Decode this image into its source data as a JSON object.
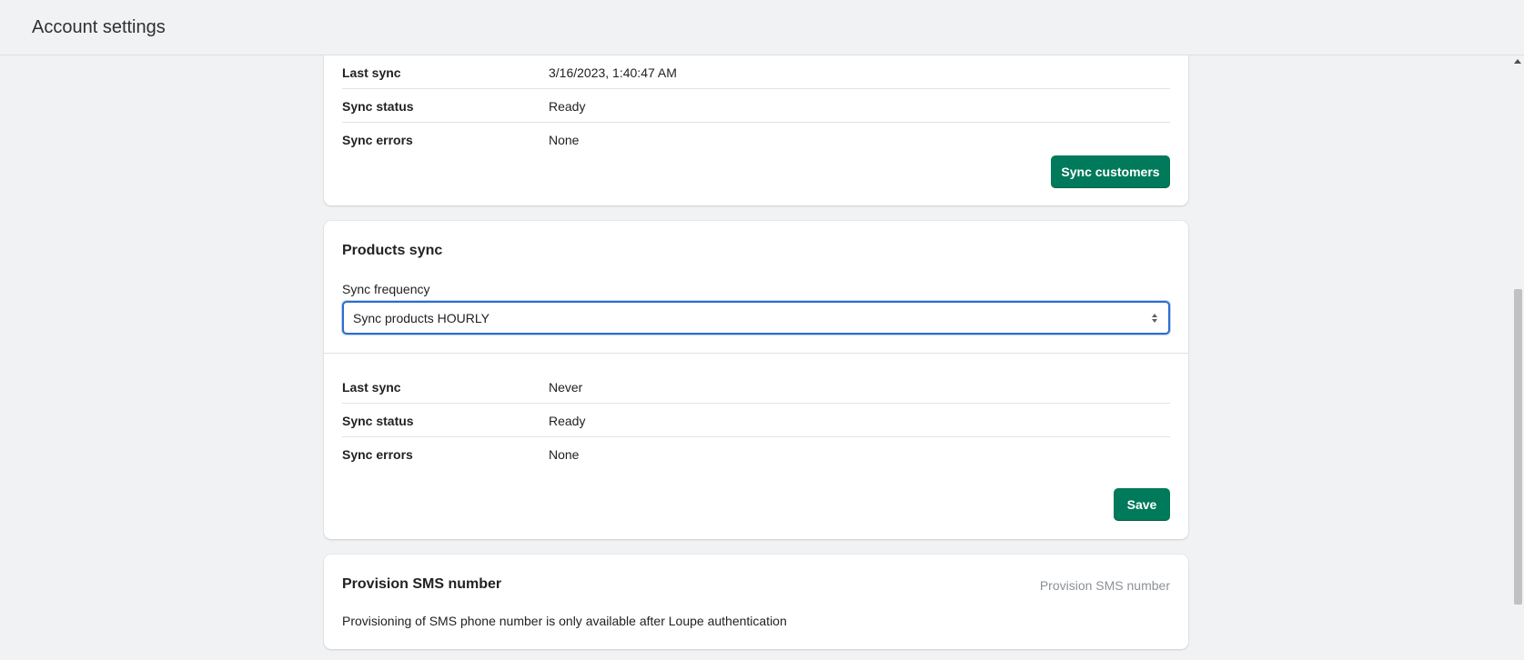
{
  "header": {
    "title": "Account settings"
  },
  "customers_sync": {
    "rows": [
      {
        "key": "Last sync",
        "value": "3/16/2023, 1:40:47 AM"
      },
      {
        "key": "Sync status",
        "value": "Ready"
      },
      {
        "key": "Sync errors",
        "value": "None"
      }
    ],
    "button_label": "Sync customers"
  },
  "products_sync": {
    "title": "Products sync",
    "frequency_label": "Sync frequency",
    "frequency_value": "Sync products HOURLY",
    "rows": [
      {
        "key": "Last sync",
        "value": "Never"
      },
      {
        "key": "Sync status",
        "value": "Ready"
      },
      {
        "key": "Sync errors",
        "value": "None"
      }
    ],
    "button_label": "Save"
  },
  "sms": {
    "title": "Provision SMS number",
    "action_label": "Provision SMS number",
    "description": "Provisioning of SMS phone number is only available after Loupe authentication"
  },
  "colors": {
    "primary_button": "#007a5a",
    "focus_ring": "#2c6ecb",
    "background": "#f1f2f4"
  },
  "icons": {
    "select_arrows": "chevron-up-down-icon",
    "scroll_up": "scroll-up-arrow-icon"
  }
}
